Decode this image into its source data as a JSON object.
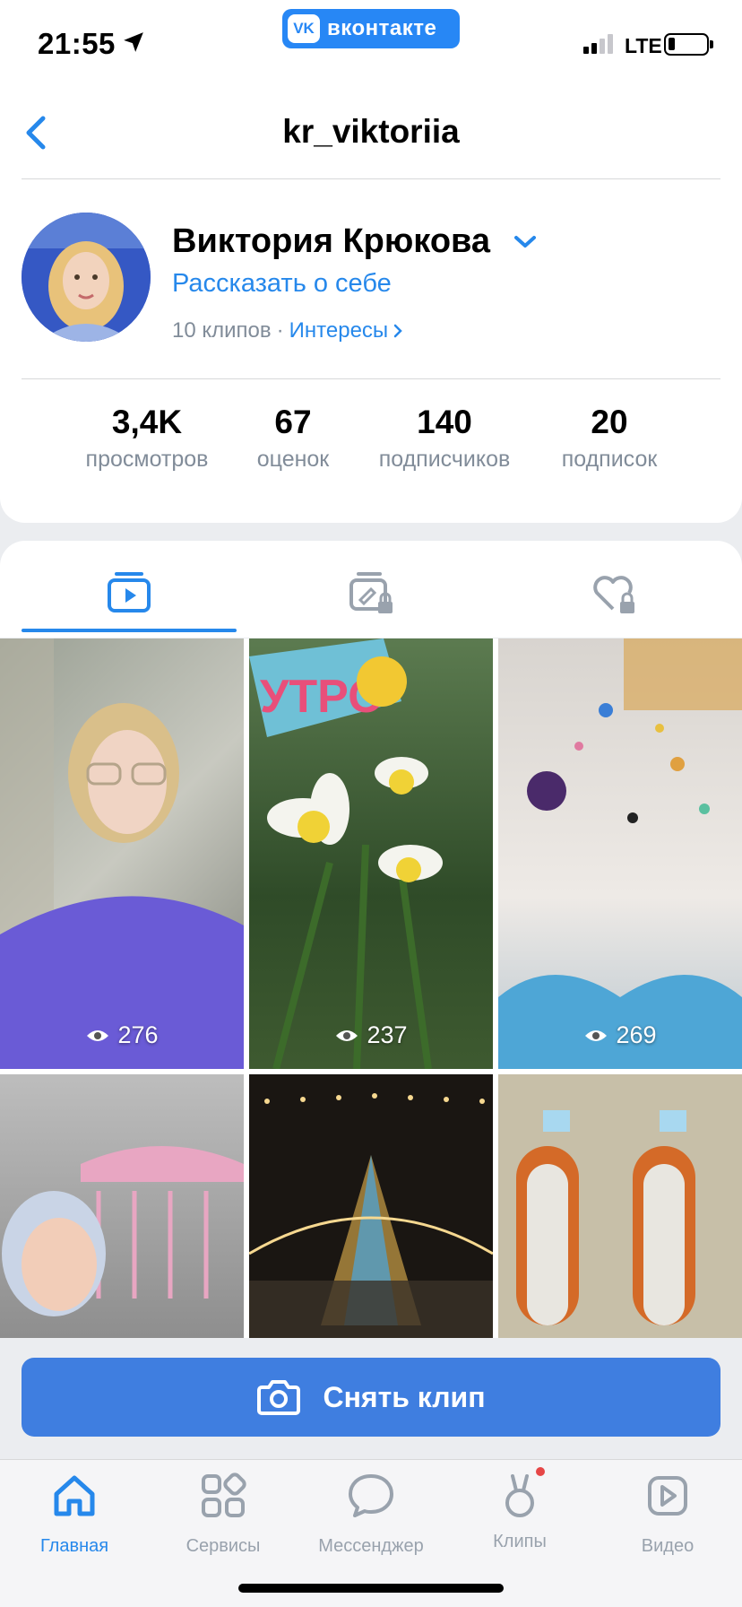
{
  "status_bar": {
    "time": "21:55",
    "app_pill": {
      "logo": "vk",
      "name": "вконтакте"
    },
    "network": "LTE"
  },
  "header": {
    "title": "kr_viktoriia"
  },
  "profile": {
    "name": "Виктория Крюкова",
    "about_link": "Рассказать о себе",
    "clips_count": "10 клипов",
    "separator": "·",
    "interests_link": "Интересы",
    "stats": [
      {
        "value": "3,4K",
        "label": "просмотров"
      },
      {
        "value": "67",
        "label": "оценок"
      },
      {
        "value": "140",
        "label": "подписчиков"
      },
      {
        "value": "20",
        "label": "подписок"
      }
    ]
  },
  "tabs": [
    {
      "icon": "clip-play-icon",
      "active": true
    },
    {
      "icon": "locked-edit-icon",
      "active": false
    },
    {
      "icon": "locked-heart-icon",
      "active": false
    }
  ],
  "clips": [
    {
      "views": "276",
      "overlay": ""
    },
    {
      "views": "237",
      "overlay": "УТРО"
    },
    {
      "views": "269",
      "overlay": ""
    },
    {
      "views": "",
      "overlay": ""
    },
    {
      "views": "",
      "overlay": ""
    },
    {
      "views": "",
      "overlay": ""
    }
  ],
  "record_button": {
    "label": "Снять клип"
  },
  "tabbar": [
    {
      "label": "Главная",
      "icon": "home-icon",
      "active": true
    },
    {
      "label": "Сервисы",
      "icon": "services-icon",
      "active": false
    },
    {
      "label": "Мессенджер",
      "icon": "messenger-icon",
      "active": false
    },
    {
      "label": "Клипы",
      "icon": "clips-icon",
      "active": false,
      "badge": true
    },
    {
      "label": "Видео",
      "icon": "video-icon",
      "active": false
    }
  ],
  "colors": {
    "accent": "#2688eb",
    "button": "#3f7ee0",
    "secondary_text": "#818c99",
    "badge": "#e64646"
  }
}
